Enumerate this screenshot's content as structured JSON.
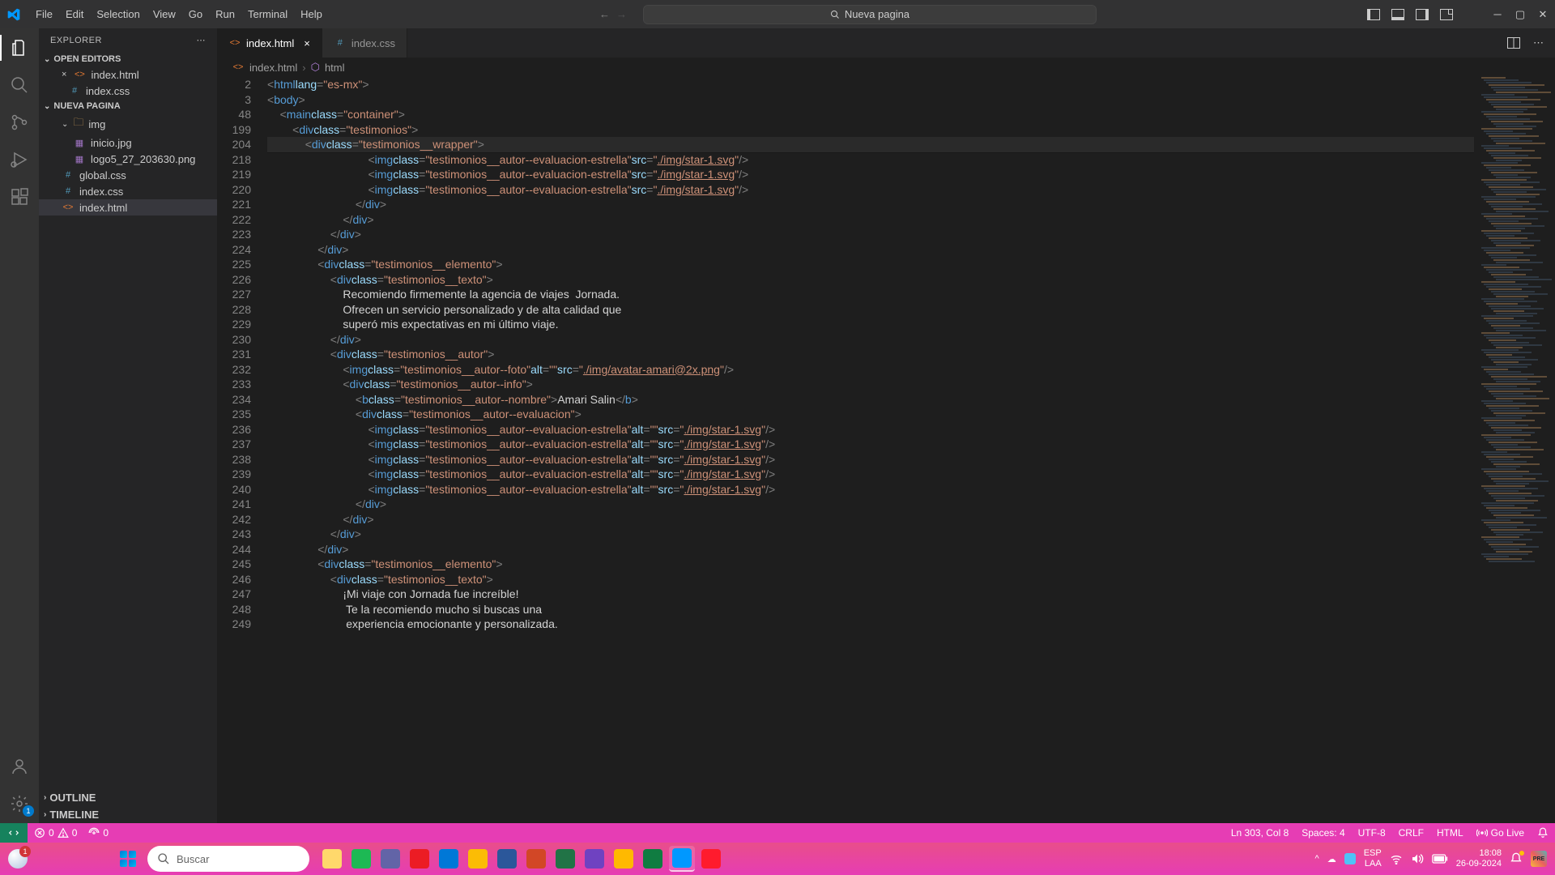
{
  "titlebar": {
    "menus": [
      "File",
      "Edit",
      "Selection",
      "View",
      "Go",
      "Run",
      "Terminal",
      "Help"
    ],
    "search_placeholder": "Nueva pagina"
  },
  "sidebar": {
    "title": "EXPLORER",
    "open_editors_label": "OPEN EDITORS",
    "open_editors": [
      {
        "name": "index.html",
        "icon": "html",
        "modified": true
      },
      {
        "name": "index.css",
        "icon": "css",
        "modified": false
      }
    ],
    "workspace_label": "NUEVA PAGINA",
    "folders": [
      {
        "name": "img",
        "children": [
          {
            "name": "inicio.jpg",
            "icon": "img"
          },
          {
            "name": "logo5_27_203630.png",
            "icon": "img"
          }
        ]
      }
    ],
    "files": [
      {
        "name": "global.css",
        "icon": "css"
      },
      {
        "name": "index.css",
        "icon": "css"
      },
      {
        "name": "index.html",
        "icon": "html",
        "selected": true
      }
    ],
    "outline_label": "OUTLINE",
    "timeline_label": "TIMELINE"
  },
  "tabs": [
    {
      "name": "index.html",
      "icon": "html",
      "active": true
    },
    {
      "name": "index.css",
      "icon": "css",
      "active": false
    }
  ],
  "breadcrumb": {
    "file": "index.html",
    "symbol": "html"
  },
  "code": {
    "sticky_lines": [
      {
        "num": 2,
        "indent": 0,
        "type": "open",
        "tag": "html",
        "attrs": [
          [
            "lang",
            "es-mx"
          ]
        ]
      },
      {
        "num": 3,
        "indent": 0,
        "type": "open",
        "tag": "body"
      },
      {
        "num": 48,
        "indent": 1,
        "type": "open",
        "tag": "main",
        "attrs": [
          [
            "class",
            "container"
          ]
        ]
      },
      {
        "num": 199,
        "indent": 2,
        "type": "open",
        "tag": "div",
        "attrs": [
          [
            "class",
            "testimonios"
          ]
        ]
      },
      {
        "num": 204,
        "indent": 3,
        "type": "open",
        "tag": "div",
        "attrs": [
          [
            "class",
            "testimonios__wrapper"
          ]
        ],
        "hl": true
      }
    ],
    "body_lines": [
      {
        "num": 218,
        "indent": 8,
        "type": "selfclose",
        "tag": "img",
        "attrs": [
          [
            "class",
            "testimonios__autor--evaluacion-estrella"
          ],
          [
            "src",
            "./img/star-1.svg",
            true
          ]
        ]
      },
      {
        "num": 219,
        "indent": 8,
        "type": "selfclose",
        "tag": "img",
        "attrs": [
          [
            "class",
            "testimonios__autor--evaluacion-estrella"
          ],
          [
            "src",
            "./img/star-1.svg",
            true
          ]
        ]
      },
      {
        "num": 220,
        "indent": 8,
        "type": "selfclose",
        "tag": "img",
        "attrs": [
          [
            "class",
            "testimonios__autor--evaluacion-estrella"
          ],
          [
            "src",
            "./img/star-1.svg",
            true
          ]
        ]
      },
      {
        "num": 221,
        "indent": 7,
        "type": "close",
        "tag": "div"
      },
      {
        "num": 222,
        "indent": 6,
        "type": "close",
        "tag": "div"
      },
      {
        "num": 223,
        "indent": 5,
        "type": "close",
        "tag": "div"
      },
      {
        "num": 224,
        "indent": 4,
        "type": "close",
        "tag": "div"
      },
      {
        "num": 225,
        "indent": 4,
        "type": "open",
        "tag": "div",
        "attrs": [
          [
            "class",
            "testimonios__elemento"
          ]
        ]
      },
      {
        "num": 226,
        "indent": 5,
        "type": "open",
        "tag": "div",
        "attrs": [
          [
            "class",
            "testimonios__texto"
          ]
        ]
      },
      {
        "num": 227,
        "indent": 6,
        "type": "text",
        "text": "Recomiendo firmemente la agencia de viajes  Jornada."
      },
      {
        "num": 228,
        "indent": 6,
        "type": "text",
        "text": "Ofrecen un servicio personalizado y de alta calidad que"
      },
      {
        "num": 229,
        "indent": 6,
        "type": "text",
        "text": "superó mis expectativas en mi último viaje."
      },
      {
        "num": 230,
        "indent": 5,
        "type": "close",
        "tag": "div"
      },
      {
        "num": 231,
        "indent": 5,
        "type": "open",
        "tag": "div",
        "attrs": [
          [
            "class",
            "testimonios__autor"
          ]
        ]
      },
      {
        "num": 232,
        "indent": 6,
        "type": "selfclose",
        "tag": "img",
        "attrs": [
          [
            "class",
            "testimonios__autor--foto"
          ],
          [
            "alt",
            ""
          ],
          [
            "src",
            "./img/avatar-amari@2x.png",
            true
          ]
        ]
      },
      {
        "num": 233,
        "indent": 6,
        "type": "open",
        "tag": "div",
        "attrs": [
          [
            "class",
            "testimonios__autor--info"
          ]
        ]
      },
      {
        "num": 234,
        "indent": 7,
        "type": "b",
        "attrs": [
          [
            "class",
            "testimonios__autor--nombre"
          ]
        ],
        "text": "Amari Salin"
      },
      {
        "num": 235,
        "indent": 7,
        "type": "open",
        "tag": "div",
        "attrs": [
          [
            "class",
            "testimonios__autor--evaluacion"
          ]
        ]
      },
      {
        "num": 236,
        "indent": 8,
        "type": "selfclose",
        "tag": "img",
        "attrs": [
          [
            "class",
            "testimonios__autor--evaluacion-estrella"
          ],
          [
            "alt",
            ""
          ],
          [
            "src",
            "./img/star-1.svg",
            true
          ]
        ]
      },
      {
        "num": 237,
        "indent": 8,
        "type": "selfclose",
        "tag": "img",
        "attrs": [
          [
            "class",
            "testimonios__autor--evaluacion-estrella"
          ],
          [
            "alt",
            ""
          ],
          [
            "src",
            "./img/star-1.svg",
            true
          ]
        ]
      },
      {
        "num": 238,
        "indent": 8,
        "type": "selfclose",
        "tag": "img",
        "attrs": [
          [
            "class",
            "testimonios__autor--evaluacion-estrella"
          ],
          [
            "alt",
            ""
          ],
          [
            "src",
            "./img/star-1.svg",
            true
          ]
        ]
      },
      {
        "num": 239,
        "indent": 8,
        "type": "selfclose",
        "tag": "img",
        "attrs": [
          [
            "class",
            "testimonios__autor--evaluacion-estrella"
          ],
          [
            "alt",
            ""
          ],
          [
            "src",
            "./img/star-1.svg",
            true
          ]
        ]
      },
      {
        "num": 240,
        "indent": 8,
        "type": "selfclose",
        "tag": "img",
        "attrs": [
          [
            "class",
            "testimonios__autor--evaluacion-estrella"
          ],
          [
            "alt",
            ""
          ],
          [
            "src",
            "./img/star-1.svg",
            true
          ]
        ]
      },
      {
        "num": 241,
        "indent": 7,
        "type": "close",
        "tag": "div"
      },
      {
        "num": 242,
        "indent": 6,
        "type": "close",
        "tag": "div"
      },
      {
        "num": 243,
        "indent": 5,
        "type": "close",
        "tag": "div"
      },
      {
        "num": 244,
        "indent": 4,
        "type": "close",
        "tag": "div"
      },
      {
        "num": 245,
        "indent": 4,
        "type": "open",
        "tag": "div",
        "attrs": [
          [
            "class",
            "testimonios__elemento"
          ]
        ]
      },
      {
        "num": 246,
        "indent": 5,
        "type": "open",
        "tag": "div",
        "attrs": [
          [
            "class",
            "testimonios__texto"
          ]
        ]
      },
      {
        "num": 247,
        "indent": 6,
        "type": "text",
        "text": "¡Mi viaje con Jornada fue increíble!"
      },
      {
        "num": 248,
        "indent": 6,
        "type": "text",
        "text": " Te la recomiendo mucho si buscas una"
      },
      {
        "num": 249,
        "indent": 6,
        "type": "text",
        "text": " experiencia emocionante y personalizada."
      }
    ]
  },
  "statusbar": {
    "errors": "0",
    "warnings": "0",
    "ports": "0",
    "cursor": "Ln 303, Col 8",
    "spaces": "Spaces: 4",
    "encoding": "UTF-8",
    "eol": "CRLF",
    "lang": "HTML",
    "golive": "Go Live"
  },
  "taskbar": {
    "search_placeholder": "Buscar",
    "weather_badge": "1",
    "lang": "ESP",
    "kb": "LAA",
    "time": "18:08",
    "date": "26-09-2024",
    "icons": [
      "explorer",
      "spotify",
      "teams",
      "acrobat",
      "edge",
      "chrome",
      "word",
      "powerpoint",
      "excel",
      "copilot",
      "files",
      "project",
      "vscode",
      "opera"
    ]
  }
}
